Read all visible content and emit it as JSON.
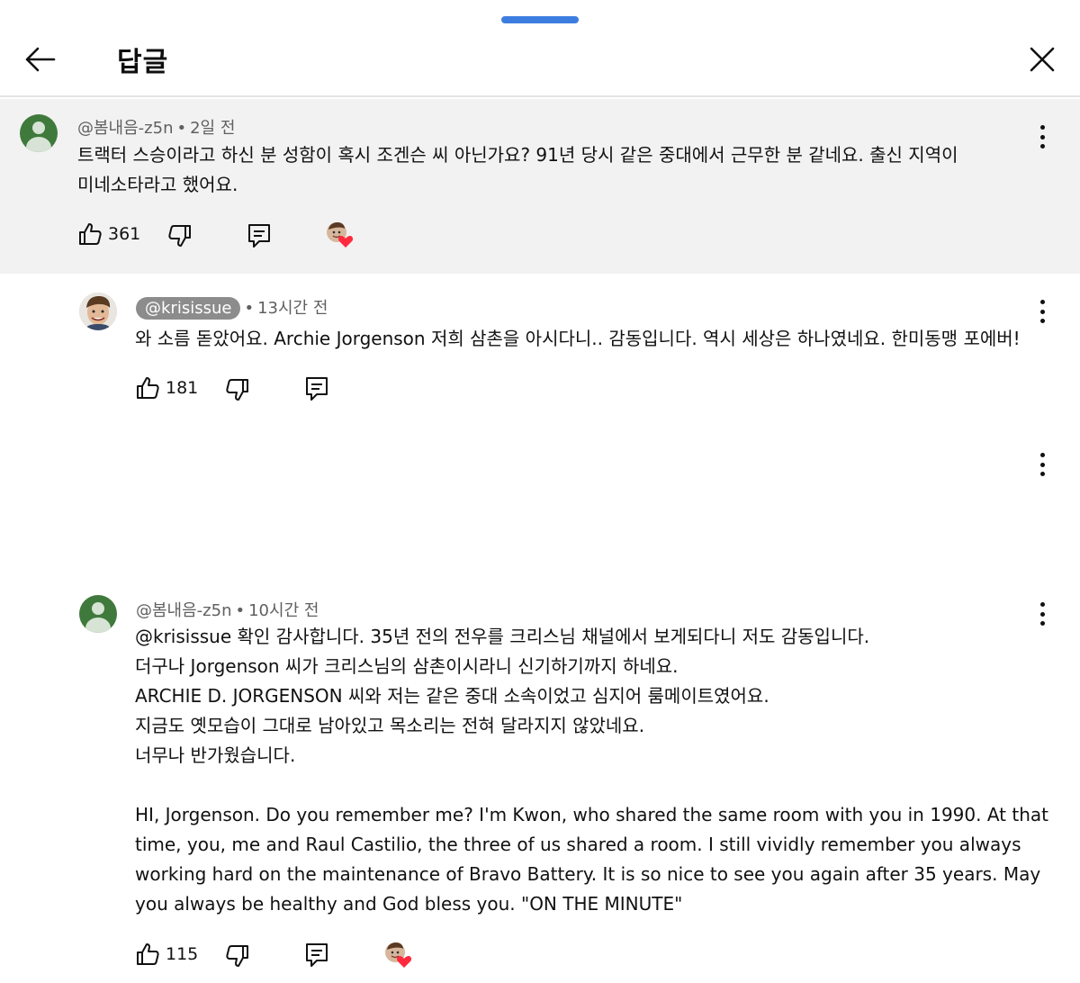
{
  "header": {
    "title": "답글",
    "back_icon": "arrow-left-icon",
    "close_icon": "close-icon"
  },
  "parent": {
    "author": "@봄내음-z5n",
    "time": "2일 전",
    "lines": [
      "트랙터 스승이라고 하신 분 성함이 혹시 조겐슨 씨 아닌가요? 91년 당시 같은 중대에서 근무한 분 같네요. 출신 지역이",
      "미네소타라고 했어요."
    ],
    "likes": "361"
  },
  "replies": [
    {
      "author": "@krisissue",
      "time": "13시간 전",
      "lines": [
        "와 소름 돋았어요. Archie Jorgenson 저희 삼촌을 아시다니.. 감동입니다. 역시 세상은 하나였네요. 한미동맹 포에버!"
      ],
      "likes": "181"
    },
    {
      "author": "@봄내음-z5n",
      "time": "10시간 전",
      "lines": [
        "@krisissue 확인 감사합니다. 35년 전의 전우를 크리스님 채널에서 보게되다니 저도 감동입니다.",
        "더구나 Jorgenson 씨가 크리스님의 삼촌이시라니 신기하기까지 하네요.",
        "ARCHIE D. JORGENSON 씨와 저는 같은 중대 소속이었고 심지어 룸메이트였어요.",
        "지금도 옛모습이 그대로 남아있고 목소리는 전혀 달라지지 않았네요.",
        "너무나 반가웠습니다.",
        "",
        "HI, Jorgenson. Do you remember me? I'm Kwon, who shared the same room with you in 1990. At that",
        "time, you, me and Raul Castilio, the three of us shared a room. I still vividly remember you always",
        "working hard on the maintenance of Bravo Battery. It is so nice to see you again after 35 years. May",
        "you always be healthy and God bless you. \"ON THE MINUTE\""
      ],
      "likes": "115"
    }
  ],
  "dot": "•"
}
